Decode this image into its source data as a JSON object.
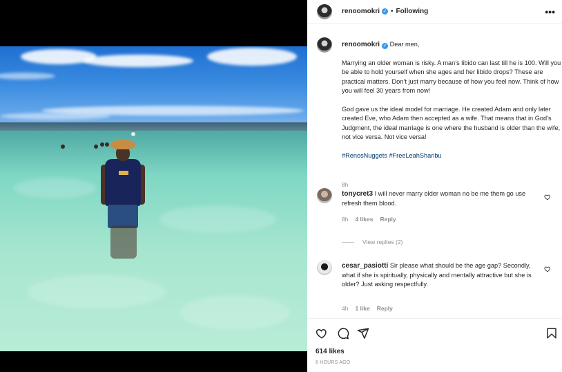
{
  "post": {
    "username": "renoomokri",
    "follow_state": "Following",
    "more_label": "•••"
  },
  "caption": {
    "username": "renoomokri",
    "greeting": "Dear men,",
    "paragraph1": "Marrying an older woman is risky. A man’s libido can last till he is 100. Will you be able to hold yourself when she ages and her libido drops? These are practical matters. Don’t just marry because of how you feel now. Think of how you will feel 30 years from now!",
    "paragraph2": "God gave us the ideal model for marriage. He created Adam and only later created Eve, who Adam then accepted as a wife. That means that in God’s Judgment, the ideal marriage is one where the husband is older than the wife, not vice versa. Not vice versa!",
    "hashtags": "#RenosNuggets #FreeLeahSharibu",
    "time": "8h"
  },
  "comments": [
    {
      "username": "tonycret3",
      "text": "I will never marry older woman no be me them go use refresh them blood.",
      "time": "8h",
      "likes": "4 likes",
      "reply": "Reply",
      "view_replies": "View replies (2)"
    },
    {
      "username": "cesar_pasiotti",
      "text": "Sir please what should be the age gap? Secondly, what if she is spiritually, physically and mentally attractive but she is older? Just asking respectfully.",
      "time": "4h",
      "likes": "1 like",
      "reply": "Reply"
    }
  ],
  "footer": {
    "likes": "614 likes",
    "ago": "8 HOURS AGO"
  },
  "colors": {
    "verified": "#3897f0",
    "hashtag": "#00376b",
    "muted": "#8e8e8e"
  },
  "icons": [
    "heart-icon",
    "comment-icon",
    "share-icon",
    "bookmark-icon",
    "more-options-icon",
    "verified-badge-icon"
  ]
}
